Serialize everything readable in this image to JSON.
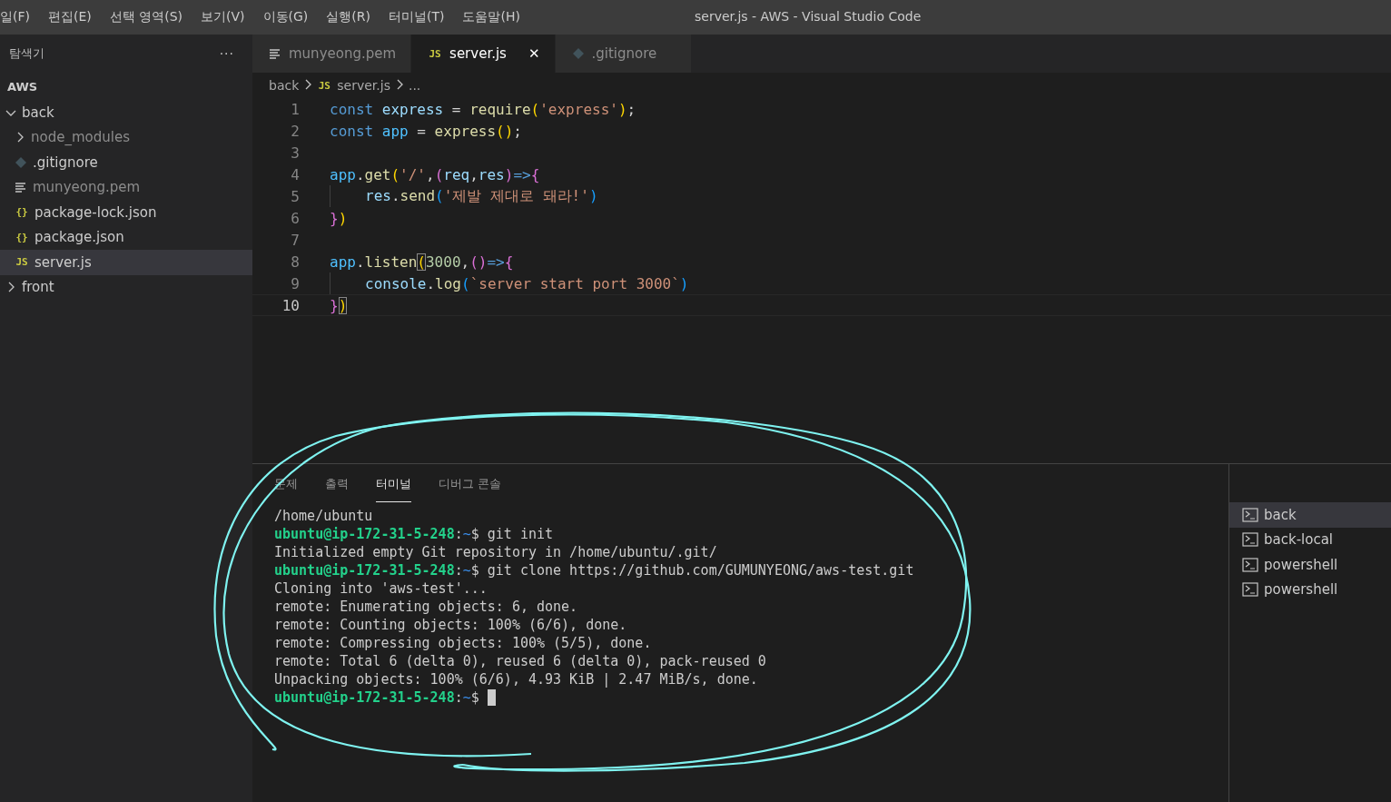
{
  "menu": [
    "일(F)",
    "편집(E)",
    "선택 영역(S)",
    "보기(V)",
    "이동(G)",
    "실행(R)",
    "터미널(T)",
    "도움말(H)"
  ],
  "window": {
    "title": "server.js - AWS - Visual Studio Code"
  },
  "sidebar": {
    "title": "탐색기",
    "more": "···",
    "section": "AWS",
    "tree": [
      {
        "label": "back",
        "kind": "folder",
        "expanded": true,
        "selected": false,
        "dimmed": false,
        "children": [
          {
            "label": "node_modules",
            "kind": "folder",
            "expanded": false,
            "selected": false,
            "dimmed": true
          },
          {
            "label": ".gitignore",
            "kind": "git",
            "selected": false,
            "dimmed": false
          },
          {
            "label": "munyeong.pem",
            "kind": "text",
            "selected": false,
            "dimmed": true
          },
          {
            "label": "package-lock.json",
            "kind": "json",
            "glyph": "{}",
            "selected": false,
            "dimmed": false
          },
          {
            "label": "package.json",
            "kind": "json",
            "glyph": "{}",
            "selected": false,
            "dimmed": false
          },
          {
            "label": "server.js",
            "kind": "js",
            "glyph": "JS",
            "selected": true,
            "dimmed": false
          }
        ]
      },
      {
        "label": "front",
        "kind": "folder",
        "expanded": false,
        "selected": false,
        "dimmed": false
      }
    ]
  },
  "tabs": [
    {
      "label": "munyeong.pem",
      "kind": "text",
      "selected": false
    },
    {
      "label": "server.js",
      "kind": "js",
      "glyph": "JS",
      "selected": true,
      "close": "✕"
    },
    {
      "label": ".gitignore",
      "kind": "git",
      "selected": false
    }
  ],
  "breadcrumb": [
    {
      "label": "back"
    },
    {
      "label": "server.js",
      "glyph": "JS"
    },
    {
      "label": "..."
    }
  ],
  "code": [
    {
      "number": "1",
      "current": false,
      "tokens": [
        {
          "kind": "kw",
          "text": "const "
        },
        {
          "kind": "var",
          "text": "express"
        },
        {
          "kind": "plain",
          "text": " = "
        },
        {
          "kind": "fn",
          "text": "require"
        },
        {
          "kind": "br1",
          "text": "("
        },
        {
          "kind": "str",
          "text": "'express'"
        },
        {
          "kind": "br1",
          "text": ")"
        },
        {
          "kind": "plain",
          "text": ";"
        }
      ]
    },
    {
      "number": "2",
      "current": false,
      "tokens": [
        {
          "kind": "kw",
          "text": "const "
        },
        {
          "kind": "const",
          "text": "app"
        },
        {
          "kind": "plain",
          "text": " = "
        },
        {
          "kind": "fn",
          "text": "express"
        },
        {
          "kind": "br1",
          "text": "()"
        },
        {
          "kind": "plain",
          "text": ";"
        }
      ]
    },
    {
      "number": "3",
      "current": false
    },
    {
      "number": "4",
      "current": false,
      "tokens": [
        {
          "kind": "const",
          "text": "app"
        },
        {
          "kind": "plain",
          "text": "."
        },
        {
          "kind": "fn",
          "text": "get"
        },
        {
          "kind": "br1",
          "text": "("
        },
        {
          "kind": "str",
          "text": "'/'"
        },
        {
          "kind": "plain",
          "text": ","
        },
        {
          "kind": "br2",
          "text": "("
        },
        {
          "kind": "var",
          "text": "req"
        },
        {
          "kind": "plain",
          "text": ","
        },
        {
          "kind": "var",
          "text": "res"
        },
        {
          "kind": "br2",
          "text": ")"
        },
        {
          "kind": "kw",
          "text": "=>"
        },
        {
          "kind": "br2",
          "text": "{"
        }
      ]
    },
    {
      "number": "5",
      "current": false,
      "indented": true,
      "tokens": [
        {
          "kind": "var",
          "text": "res"
        },
        {
          "kind": "plain",
          "text": "."
        },
        {
          "kind": "fn",
          "text": "send"
        },
        {
          "kind": "br3",
          "text": "("
        },
        {
          "kind": "str",
          "text": "'제발 제대로 돼라!'"
        },
        {
          "kind": "br3",
          "text": ")"
        }
      ]
    },
    {
      "number": "6",
      "current": false,
      "tokens": [
        {
          "kind": "br2",
          "text": "}"
        },
        {
          "kind": "br1",
          "text": ")"
        }
      ]
    },
    {
      "number": "7",
      "current": false
    },
    {
      "number": "8",
      "current": false,
      "tokens": [
        {
          "kind": "const",
          "text": "app"
        },
        {
          "kind": "plain",
          "text": "."
        },
        {
          "kind": "fn",
          "text": "listen"
        },
        {
          "kind": "match1",
          "text": "("
        },
        {
          "kind": "num",
          "text": "3000"
        },
        {
          "kind": "plain",
          "text": ","
        },
        {
          "kind": "br2",
          "text": "()"
        },
        {
          "kind": "kw",
          "text": "=>"
        },
        {
          "kind": "br2",
          "text": "{"
        }
      ]
    },
    {
      "number": "9",
      "current": false,
      "indented": true,
      "tokens": [
        {
          "kind": "var",
          "text": "console"
        },
        {
          "kind": "plain",
          "text": "."
        },
        {
          "kind": "fn",
          "text": "log"
        },
        {
          "kind": "br3",
          "text": "("
        },
        {
          "kind": "str",
          "text": "`server start port 3000`"
        },
        {
          "kind": "br3",
          "text": ")"
        }
      ]
    },
    {
      "number": "10",
      "current": true,
      "tokens": [
        {
          "kind": "br2",
          "text": "}"
        },
        {
          "kind": "match1",
          "text": ")"
        }
      ]
    }
  ],
  "panel": {
    "tabs": [
      {
        "label": "문제",
        "selected": false
      },
      {
        "label": "출력",
        "selected": false
      },
      {
        "label": "터미널",
        "selected": true
      },
      {
        "label": "디버그 콘솔",
        "selected": false
      }
    ],
    "terminal": [
      [
        {
          "kind": "plain",
          "text": "/home/ubuntu"
        }
      ],
      [
        {
          "kind": "prompt",
          "text": "ubuntu@ip-172-31-5-248"
        },
        {
          "kind": "plain",
          "text": ":"
        },
        {
          "kind": "path",
          "text": "~"
        },
        {
          "kind": "plain",
          "text": "$ git init"
        }
      ],
      [
        {
          "kind": "plain",
          "text": "Initialized empty Git repository in /home/ubuntu/.git/"
        }
      ],
      [
        {
          "kind": "prompt",
          "text": "ubuntu@ip-172-31-5-248"
        },
        {
          "kind": "plain",
          "text": ":"
        },
        {
          "kind": "path",
          "text": "~"
        },
        {
          "kind": "plain",
          "text": "$ git clone https://github.com/GUMUNYEONG/aws-test.git"
        }
      ],
      [
        {
          "kind": "plain",
          "text": "Cloning into 'aws-test'..."
        }
      ],
      [
        {
          "kind": "plain",
          "text": "remote: Enumerating objects: 6, done."
        }
      ],
      [
        {
          "kind": "plain",
          "text": "remote: Counting objects: 100% (6/6), done."
        }
      ],
      [
        {
          "kind": "plain",
          "text": "remote: Compressing objects: 100% (5/5), done."
        }
      ],
      [
        {
          "kind": "plain",
          "text": "remote: Total 6 (delta 0), reused 6 (delta 0), pack-reused 0"
        }
      ],
      [
        {
          "kind": "plain",
          "text": "Unpacking objects: 100% (6/6), 4.93 KiB | 2.47 MiB/s, done."
        }
      ],
      [
        {
          "kind": "prompt",
          "text": "ubuntu@ip-172-31-5-248"
        },
        {
          "kind": "plain",
          "text": ":"
        },
        {
          "kind": "path",
          "text": "~"
        },
        {
          "kind": "plain",
          "text": "$ "
        },
        {
          "kind": "cursor"
        }
      ]
    ],
    "terminals": [
      {
        "label": "back",
        "selected": true
      },
      {
        "label": "back-local",
        "selected": false
      },
      {
        "label": "powershell",
        "selected": false
      },
      {
        "label": "powershell",
        "selected": false
      }
    ]
  }
}
